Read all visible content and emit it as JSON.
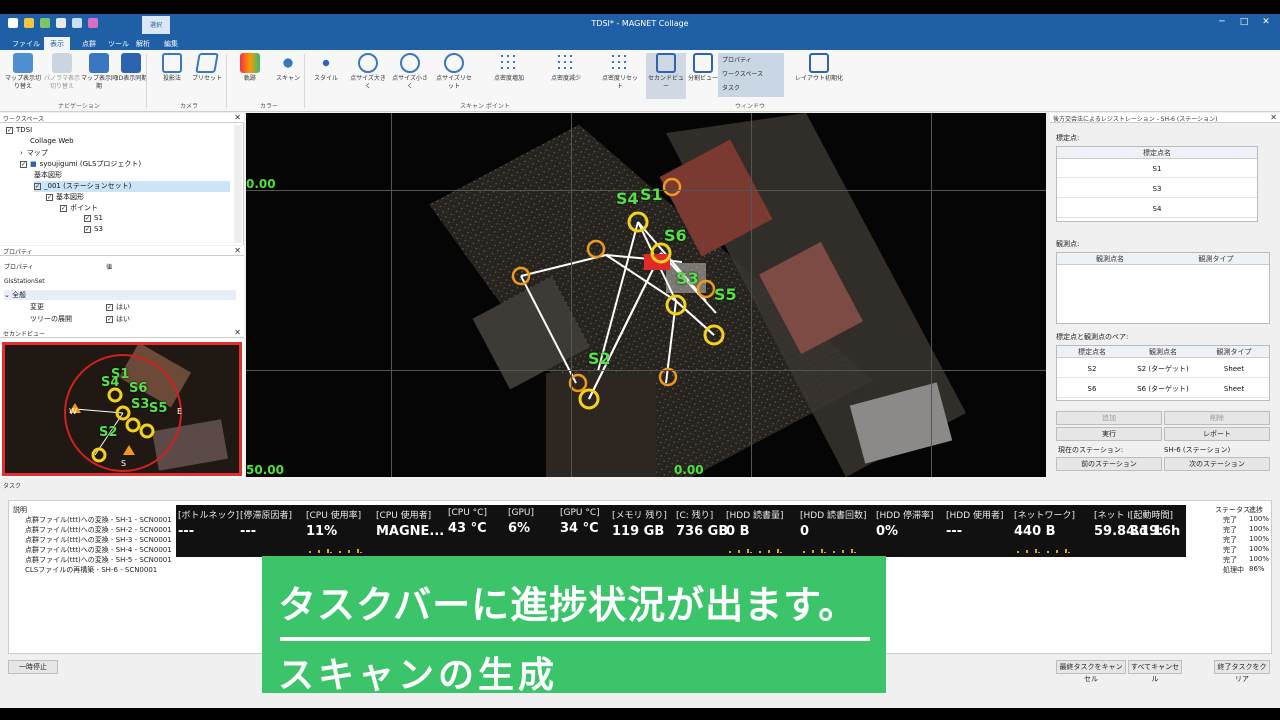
{
  "window": {
    "title": "TDSI* - MAGNET Collage"
  },
  "tabs": [
    {
      "label": "ファイル"
    },
    {
      "label": "表示"
    },
    {
      "label": "点群"
    },
    {
      "label": "ツール"
    },
    {
      "label": "解析"
    },
    {
      "label": "編集"
    }
  ],
  "context_tab_group": "選択",
  "ribbon": {
    "buttons": [
      {
        "label": "マップ表示切り替え"
      },
      {
        "label": "パノラマ表示切り替え"
      },
      {
        "label": "マップ表示同期"
      },
      {
        "label": "3D表示同期"
      },
      {
        "label": "投影法"
      },
      {
        "label": "プリセット"
      },
      {
        "label": "軌跡"
      },
      {
        "label": "スキャン"
      },
      {
        "label": "スタイル"
      },
      {
        "label": "点サイズ大きく"
      },
      {
        "label": "点サイズ小さく"
      },
      {
        "label": "点サイズリセット"
      },
      {
        "label": "点密度増加"
      },
      {
        "label": "点密度減少"
      },
      {
        "label": "点密度リセット"
      },
      {
        "label": "セカンドビュー"
      },
      {
        "label": "分割ビュー"
      },
      {
        "label": "レイアウト初期化"
      }
    ],
    "window_list": [
      "プロパティ",
      "ワークスペース",
      "タスク"
    ],
    "groups": {
      "navigation": "ナビゲーション",
      "camera": "カメラ",
      "color": "カラー",
      "scan_point": "スキャン ポイント",
      "window": "ウィンドウ"
    }
  },
  "workspace": {
    "header": "ワークスペース",
    "items": [
      {
        "label": "TDSI"
      },
      {
        "label": "Collage Web"
      },
      {
        "label": "マップ"
      },
      {
        "label": "syoujigumi (GLSプロジェクト)"
      },
      {
        "label": "基本図形"
      },
      {
        "label": "_001 (ステーションセット)"
      },
      {
        "label": "基本図形"
      },
      {
        "label": "ポイント"
      },
      {
        "label": "S1"
      },
      {
        "label": "S3"
      }
    ]
  },
  "properties": {
    "header": "プロパティ",
    "col_property": "プロパティ",
    "col_value": "値",
    "type": "GlsStationSet",
    "section": "全般",
    "rows": [
      {
        "name": "変更",
        "value": "はい"
      },
      {
        "name": "ツリーの展開",
        "value": "はい"
      }
    ]
  },
  "second_view": {
    "header": "セカンドビュー",
    "labels": [
      "S1",
      "S4",
      "S6",
      "S3",
      "S5",
      "S2"
    ],
    "compass_w": "W",
    "compass_e": "E",
    "compass_s": "S"
  },
  "viewport": {
    "coord_top": "0.00",
    "coord_bottom_left": "50.00",
    "coord_bottom_mid": "0.00",
    "point_labels": [
      "S4",
      "S1",
      "S6",
      "S3",
      "S5",
      "S2"
    ]
  },
  "registration": {
    "header": "後方交会法によるレジストレーション - SH-6 (ステーション)",
    "control_points_label": "標定点:",
    "control_points_col": "標定点名",
    "control_points": [
      "S1",
      "S3",
      "S4"
    ],
    "observations_label": "観測点:",
    "obs_col_name": "観測点名",
    "obs_col_type": "観測タイプ",
    "pairs_label": "標定点と観測点のペア:",
    "pairs_cols": [
      "標定点名",
      "観測点名",
      "観測タイプ"
    ],
    "pairs": [
      {
        "control": "S2",
        "obs": "S2 (ターゲット)",
        "type": "Sheet"
      },
      {
        "control": "S6",
        "obs": "S6 (ターゲット)",
        "type": "Sheet"
      }
    ],
    "btn_add": "追加",
    "btn_delete": "削除",
    "btn_run": "実行",
    "btn_report": "レポート",
    "current_station_label": "現在のステーション:",
    "current_station_value": "SH-6 (ステーション)",
    "btn_prev": "前のステーション",
    "btn_next": "次のステーション"
  },
  "tasks": {
    "header": "タスク",
    "col_desc": "説明",
    "col_status": "ステータス",
    "col_progress": "進捗",
    "rows": [
      {
        "desc": "点群ファイル(ttt)への変換 - SH-1 - SCN0001",
        "status": "完了",
        "progress": "100%"
      },
      {
        "desc": "点群ファイル(ttt)への変換 - SH-2 - SCN0001",
        "status": "完了",
        "progress": "100%"
      },
      {
        "desc": "点群ファイル(ttt)への変換 - SH-3 - SCN0001",
        "status": "完了",
        "progress": "100%"
      },
      {
        "desc": "点群ファイル(ttt)への変換 - SH-4 - SCN0001",
        "status": "完了",
        "progress": "100%"
      },
      {
        "desc": "点群ファイル(ttt)への変換 - SH-5 - SCN0001",
        "status": "完了",
        "progress": "100%"
      },
      {
        "desc": "CLSファイルの再構築 - SH-6 - SCN0001",
        "status": "処理中",
        "progress": "86%"
      }
    ],
    "btn_pause": "一時停止",
    "btn_cancel_last": "最終タスクをキャンセル",
    "btn_cancel_all": "すべてキャンセル",
    "btn_clear_done": "終了タスクをクリア"
  },
  "perf": [
    {
      "h": "[ボトルネック]",
      "v": "---"
    },
    {
      "h": "[停滞原因者]",
      "v": "---"
    },
    {
      "h": "[CPU 使用率]",
      "v": "11%"
    },
    {
      "h": "[CPU 使用者]",
      "v": "MAGNE..."
    },
    {
      "h": "[CPU °C]",
      "v": "43 °C"
    },
    {
      "h": "[GPU]",
      "v": "6%"
    },
    {
      "h": "[GPU °C]",
      "v": "34 °C"
    },
    {
      "h": "[メモリ 残り]",
      "v": "119 GB"
    },
    {
      "h": "[C: 残り]",
      "v": "736 GB"
    },
    {
      "h": "[HDD 読書量]",
      "v": "0 B"
    },
    {
      "h": "[HDD 読書回数]",
      "v": "0"
    },
    {
      "h": "[HDD 停滞率]",
      "v": "0%"
    },
    {
      "h": "[HDD 使用者]",
      "v": "---"
    },
    {
      "h": "[ネットワーク]",
      "v": "440 B"
    },
    {
      "h": "[ネット I",
      "v": "59.84.19:"
    },
    {
      "h": "[起動時間]",
      "v": "3d 16h"
    }
  ],
  "caption": {
    "line1": "タスクバーに進捗状況が出ます。",
    "line2": "スキャンの生成"
  },
  "colors": {
    "title_blue": "#1f5fa6",
    "caption_green": "#3cc46a",
    "point_green": "#56e04a",
    "target_yellow": "#f2d21c",
    "station_orange": "#f09a1a"
  }
}
